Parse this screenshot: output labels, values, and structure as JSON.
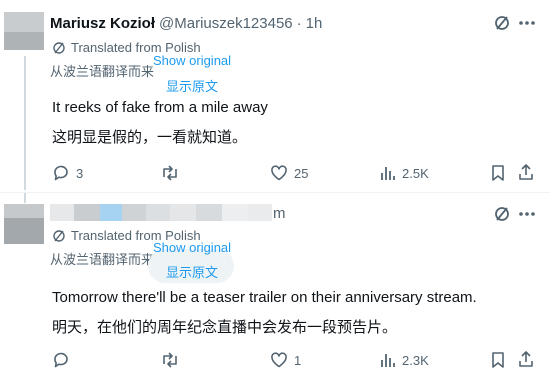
{
  "tweets": [
    {
      "author_name": "Mariusz Kozioł",
      "author_handle": "@Mariuszek123456",
      "time_sep": "·",
      "time": "1h",
      "translated_label": "Translated from Polish",
      "translated_cn": "从波兰语翻译而来",
      "show_original": "Show original",
      "show_original_cn": "显示原文",
      "text_en": "It reeks of fake from a mile away",
      "text_cn": "这明显是假的，一看就知道。",
      "replies": "3",
      "retweets": "",
      "likes": "25",
      "views": "2.5K"
    },
    {
      "author_name_visible": "m",
      "translated_label": "Translated from Polish",
      "translated_cn": "从波兰语翻译而来",
      "show_original": "Show original",
      "show_original_cn": "显示原文",
      "text_en": "Tomorrow there'll be a teaser trailer on their anniversary stream.",
      "text_cn": "明天，在他们的周年纪念直播中会发布一段预告片。",
      "replies": "",
      "retweets": "",
      "likes": "1",
      "views": "2.3K"
    }
  ],
  "icons": {
    "grok": "grok-slash-icon",
    "more": "more-dots-icon",
    "reply": "reply-bubble-icon",
    "retweet": "retweet-icon",
    "like": "heart-icon",
    "views": "views-bars-icon",
    "bookmark": "bookmark-icon",
    "share": "share-icon"
  },
  "colors": {
    "link": "#1d9bf0",
    "muted": "#536471",
    "text": "#0f1419"
  }
}
